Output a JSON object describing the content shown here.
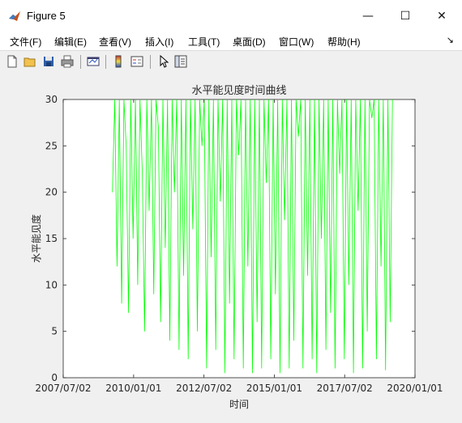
{
  "window": {
    "title": "Figure 5",
    "minimize_glyph": "—",
    "maximize_glyph": "☐",
    "close_glyph": "✕"
  },
  "menu": {
    "items": [
      "文件(F)",
      "编辑(E)",
      "查看(V)",
      "插入(I)",
      "工具(T)",
      "桌面(D)",
      "窗口(W)",
      "帮助(H)"
    ],
    "overflow_glyph": "↘"
  },
  "toolbar": {
    "icons": [
      "new-figure-icon",
      "open-file-icon",
      "save-icon",
      "print-icon",
      "link-plot-icon",
      "colorbar-icon",
      "legend-icon",
      "pointer-icon",
      "property-editor-icon"
    ]
  },
  "colors": {
    "line": "#00ff00",
    "axes_background": "#ffffff",
    "figure_background": "#f0f0f0"
  },
  "chart_data": {
    "type": "line",
    "title": "水平能见度时间曲线",
    "xlabel": "时间",
    "ylabel": "水平能见度",
    "x_tick_labels": [
      "2007/07/02",
      "2010/01/01",
      "2012/07/02",
      "2015/01/01",
      "2017/07/02",
      "2020/01/01"
    ],
    "y_tick_labels": [
      "0",
      "5",
      "10",
      "15",
      "20",
      "25",
      "30"
    ],
    "xlim": [
      "2007/07/02",
      "2020/01/01"
    ],
    "ylim": [
      0,
      30
    ],
    "grid": false,
    "legend": false,
    "series": [
      {
        "x_range": [
          "2009/04/01",
          "2019/03/15"
        ],
        "sampled_values": [
          20,
          30,
          12,
          30,
          8,
          30,
          25,
          7,
          30,
          15,
          30,
          10,
          30,
          22,
          5,
          30,
          18,
          30,
          9,
          30,
          27,
          6,
          30,
          14,
          30,
          4,
          30,
          20,
          30,
          3,
          30,
          11,
          30,
          2,
          30,
          16,
          30,
          5,
          30,
          25,
          30,
          1,
          30,
          13,
          30,
          3,
          30,
          19,
          30,
          0.5,
          30,
          8,
          30,
          2,
          30,
          24,
          30,
          1,
          30,
          12,
          30,
          0.5,
          30,
          6,
          30,
          1,
          30,
          21,
          30,
          2,
          30,
          9,
          30,
          0.5,
          30,
          17,
          30,
          1,
          30,
          4,
          30,
          26,
          30,
          1,
          30,
          11,
          30,
          2,
          30,
          0.5,
          30,
          15,
          30,
          3,
          30,
          7,
          30,
          1,
          30,
          22,
          30,
          2,
          30,
          10,
          30,
          0.5,
          30,
          18,
          30,
          1,
          30,
          5,
          30,
          28,
          30,
          2,
          30,
          12,
          30,
          0.8,
          30,
          6,
          30
        ]
      }
    ]
  }
}
